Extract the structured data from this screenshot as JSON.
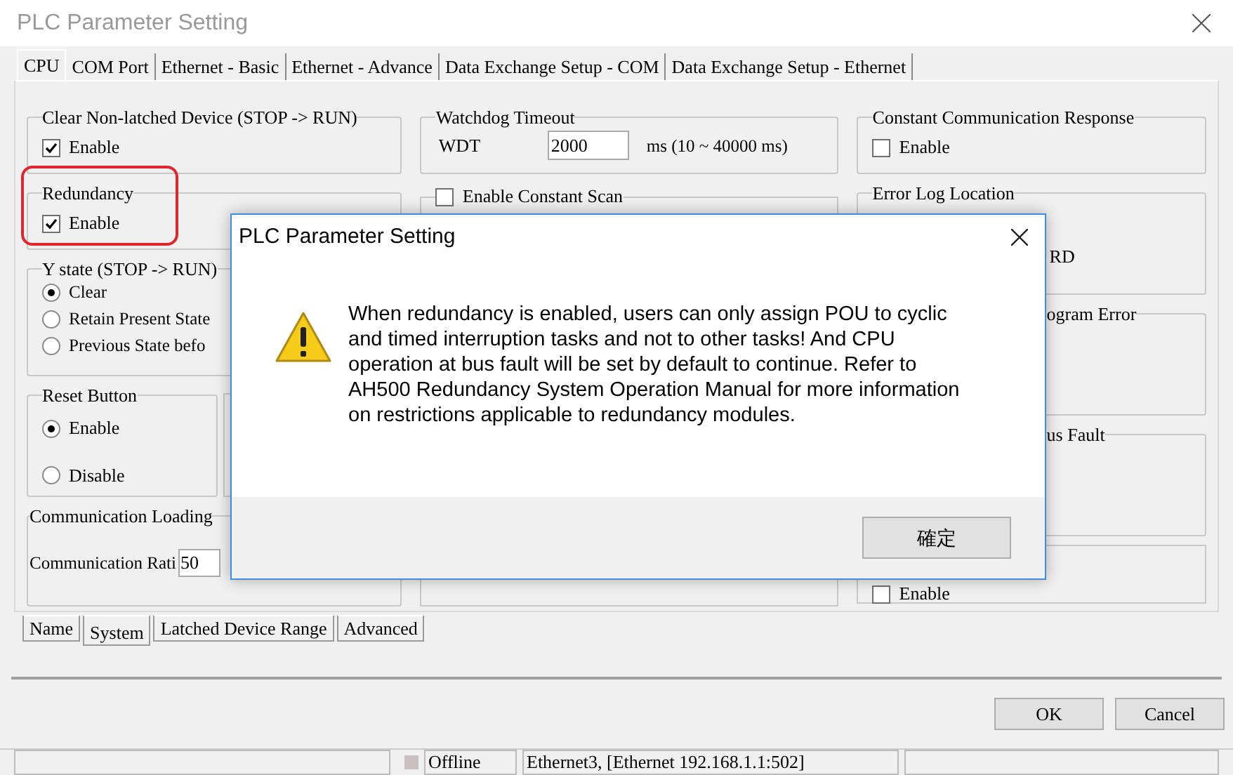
{
  "window": {
    "title": "PLC Parameter Setting"
  },
  "tabs": [
    {
      "label": "CPU",
      "selected": true
    },
    {
      "label": "COM Port",
      "selected": false
    },
    {
      "label": "Ethernet - Basic",
      "selected": false
    },
    {
      "label": "Ethernet - Advance",
      "selected": false
    },
    {
      "label": "Data Exchange Setup - COM",
      "selected": false
    },
    {
      "label": "Data Exchange Setup - Ethernet",
      "selected": false
    }
  ],
  "clear_non_latched": {
    "title": "Clear Non-latched Device (STOP -> RUN)",
    "checkbox": {
      "label": "Enable",
      "checked": true
    }
  },
  "redundancy": {
    "title": "Redundancy",
    "highlighted": true,
    "checkbox": {
      "label": "Enable",
      "checked": true
    }
  },
  "y_state": {
    "title": "Y state (STOP -> RUN)",
    "options": [
      {
        "label": "Clear",
        "selected": true
      },
      {
        "label": "Retain Present State",
        "selected": false
      },
      {
        "label": "Previous State befo",
        "selected": false
      }
    ]
  },
  "reset_button": {
    "title": "Reset Button",
    "options": [
      {
        "label": "Enable",
        "selected": true
      },
      {
        "label": "Disable",
        "selected": false
      }
    ]
  },
  "communication_loading": {
    "title": "Communication Loading",
    "field_label": "Communication Rati",
    "value": "50"
  },
  "watchdog": {
    "title": "Watchdog Timeout",
    "label": "WDT",
    "value": "2000",
    "unit": "ms (10 ~ 40000 ms)"
  },
  "constant_scan": {
    "label": "Enable Constant Scan",
    "checked": false
  },
  "constant_response": {
    "title": "Constant Communication Response",
    "checkbox": {
      "label": "Enable",
      "checked": false
    }
  },
  "error_log_location": {
    "title": "Error Log Location",
    "option_text": "RD"
  },
  "group_6": {
    "title": "ogram Error"
  },
  "group_7": {
    "title": "us Fault"
  },
  "group_8": {
    "checkbox": {
      "label": "Enable",
      "checked": false
    }
  },
  "bottom_tabs": [
    {
      "label": "Name",
      "selected": false
    },
    {
      "label": "System",
      "selected": true
    },
    {
      "label": "Latched Device Range",
      "selected": false
    },
    {
      "label": "Advanced",
      "selected": false
    }
  ],
  "dialog": {
    "title": "PLC Parameter Setting",
    "message": "When redundancy is enabled, users can only assign POU to cyclic and timed interruption tasks and not to other tasks! And CPU operation at bus fault will be set by default to continue. Refer to AH500 Redundancy System Operation Manual for more information on restrictions applicable to redundancy modules.",
    "button": "確定"
  },
  "buttons": [
    "OK",
    "Cancel"
  ],
  "status_bar": {
    "mode": "Offline",
    "connection": "Ethernet3, [Ethernet 192.168.1.1:502]"
  }
}
